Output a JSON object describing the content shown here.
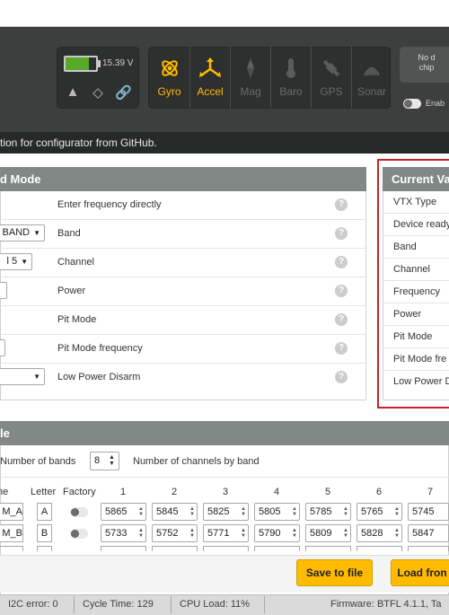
{
  "header": {
    "battery_voltage": "15.39 V",
    "battery_level": 0.75,
    "status_icons": [
      "warning-icon",
      "gem-icon",
      "link-icon"
    ],
    "sensors": [
      {
        "label": "Gyro",
        "active": true,
        "icon": "gyro-icon"
      },
      {
        "label": "Accel",
        "active": true,
        "icon": "accel-icon"
      },
      {
        "label": "Mag",
        "active": false,
        "icon": "mag-icon"
      },
      {
        "label": "Baro",
        "active": false,
        "icon": "baro-icon"
      },
      {
        "label": "GPS",
        "active": false,
        "icon": "gps-icon"
      },
      {
        "label": "Sonar",
        "active": false,
        "icon": "sonar-icon"
      }
    ],
    "nodata_line1": "No d",
    "nodata_line2": "chip",
    "enable_label": "Enab",
    "accent": "#ffbb00"
  },
  "notice": "tion for configurator from GitHub.",
  "left_panel": {
    "title": "d Mode",
    "rows": [
      {
        "label": "Enter frequency directly"
      },
      {
        "label": "Band",
        "value": "BAND"
      },
      {
        "label": "Channel",
        "value": "l 5"
      },
      {
        "label": "Power"
      },
      {
        "label": "Pit Mode"
      },
      {
        "label": "Pit Mode frequency"
      },
      {
        "label": "Low Power Disarm"
      }
    ],
    "help": "?"
  },
  "right_panel": {
    "title": "Current Va",
    "rows": [
      "VTX Type",
      "Device ready",
      "Band",
      "Channel",
      "Frequency",
      "Power",
      "Pit Mode",
      "Pit Mode fre",
      "Low Power D"
    ]
  },
  "table_panel": {
    "title": "le",
    "bands_label": "Number of bands",
    "bands_value": "8",
    "channels_label": "Number of channels by band",
    "col_name": "ne",
    "col_letter": "Letter",
    "col_factory": "Factory",
    "channel_headers": [
      "1",
      "2",
      "3",
      "4",
      "5",
      "6",
      "7"
    ],
    "rows": [
      {
        "name": "M_A",
        "letter": "A",
        "freqs": [
          "5865",
          "5845",
          "5825",
          "5805",
          "5785",
          "5765",
          "5745"
        ]
      },
      {
        "name": "M_B",
        "letter": "B",
        "freqs": [
          "5733",
          "5752",
          "5771",
          "5790",
          "5809",
          "5828",
          "5847"
        ]
      }
    ]
  },
  "buttons": {
    "save": "Save to file",
    "load": "Load fron"
  },
  "status_bar": {
    "i2c": "I2C error: 0",
    "cycle": "Cycle Time: 129",
    "cpu": "CPU Load: 11%",
    "firmware": "Firmware: BTFL 4.1.1, Ta"
  }
}
